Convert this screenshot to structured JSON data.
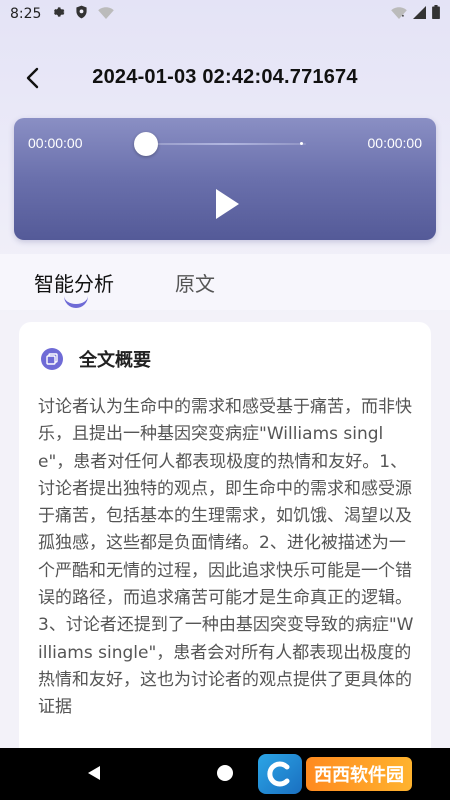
{
  "status_bar": {
    "time": "8:25",
    "icons": [
      "gear-icon",
      "shield-icon",
      "wifi-question-icon",
      "wifi-icon",
      "signal-icon",
      "battery-icon"
    ]
  },
  "header": {
    "title": "2024-01-03 02:42:04.771674"
  },
  "player": {
    "current_time": "00:00:00",
    "duration": "00:00:00",
    "progress": 0,
    "gradient_colors": [
      "#8a8fc4",
      "#545a98"
    ]
  },
  "tabs": [
    {
      "label": "智能分析",
      "active": true
    },
    {
      "label": "原文",
      "active": false
    }
  ],
  "summary": {
    "title": "全文概要",
    "text": "讨论者认为生命中的需求和感受基于痛苦，而非快乐，且提出一种基因突变病症\"Williams single\"，患者对任何人都表现极度的热情和友好。1、讨论者提出独特的观点，即生命中的需求和感受源于痛苦，包括基本的生理需求，如饥饿、渴望以及孤独感，这些都是负面情绪。2、进化被描述为一个严酷和无情的过程，因此追求快乐可能是一个错误的路径，而追求痛苦可能才是生命真正的逻辑。3、讨论者还提到了一种由基因突变导致的病症\"Williams single\"，患者会对所有人都表现出极度的热情和友好，这也为讨论者的观点提供了更具体的证据"
  },
  "watermark": {
    "text": "西西软件园"
  },
  "colors": {
    "accent": "#6f6bd6",
    "background": "#f3f2f9"
  }
}
